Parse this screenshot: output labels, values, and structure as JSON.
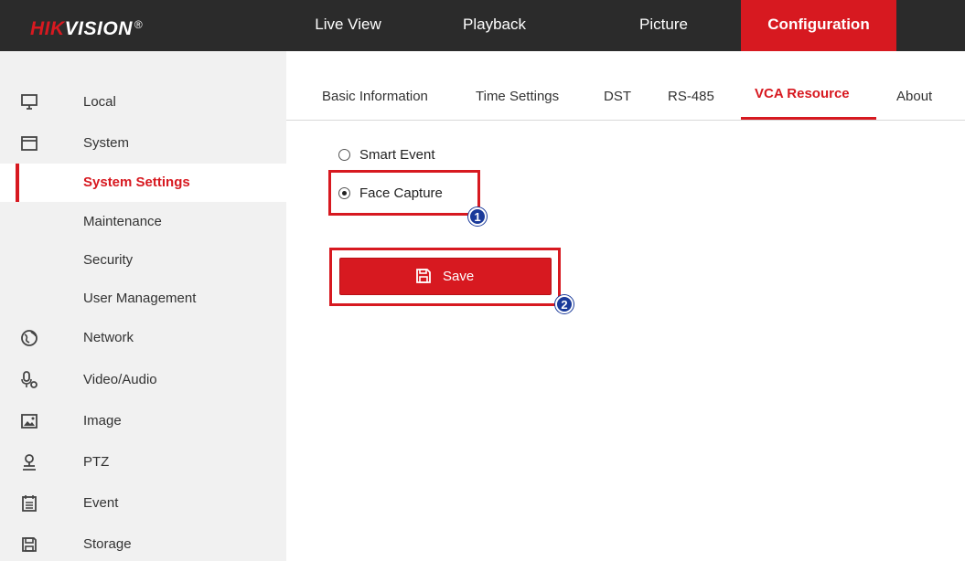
{
  "brand": {
    "part1": "HIK",
    "part2": "VISION",
    "reg": "®"
  },
  "topnav": [
    {
      "label": "Live View"
    },
    {
      "label": "Playback"
    },
    {
      "label": "Picture"
    },
    {
      "label": "Configuration",
      "active": true
    }
  ],
  "sidebar": {
    "items": [
      {
        "label": "Local",
        "icon": "monitor-icon"
      },
      {
        "label": "System",
        "icon": "system-window-icon"
      },
      {
        "label": "System Settings",
        "active": true
      },
      {
        "label": "Maintenance"
      },
      {
        "label": "Security"
      },
      {
        "label": "User Management"
      },
      {
        "label": "Network",
        "icon": "globe-icon"
      },
      {
        "label": "Video/Audio",
        "icon": "microphone-icon"
      },
      {
        "label": "Image",
        "icon": "image-icon"
      },
      {
        "label": "PTZ",
        "icon": "ptz-camera-icon"
      },
      {
        "label": "Event",
        "icon": "calendar-icon"
      },
      {
        "label": "Storage",
        "icon": "floppy-disk-icon"
      }
    ]
  },
  "tabs": [
    {
      "label": "Basic Information"
    },
    {
      "label": "Time Settings"
    },
    {
      "label": "DST"
    },
    {
      "label": "RS-485"
    },
    {
      "label": "VCA Resource",
      "active": true
    },
    {
      "label": "About"
    }
  ],
  "vca": {
    "options": [
      {
        "label": "Smart Event",
        "checked": false
      },
      {
        "label": "Face Capture",
        "checked": true
      }
    ]
  },
  "save_label": "Save",
  "annotations": {
    "badge1": "1",
    "badge2": "2"
  },
  "colors": {
    "accent": "#d71920",
    "topbar": "#2b2b2b",
    "sidebar": "#f1f1f1",
    "badge": "#1a3a9a"
  }
}
